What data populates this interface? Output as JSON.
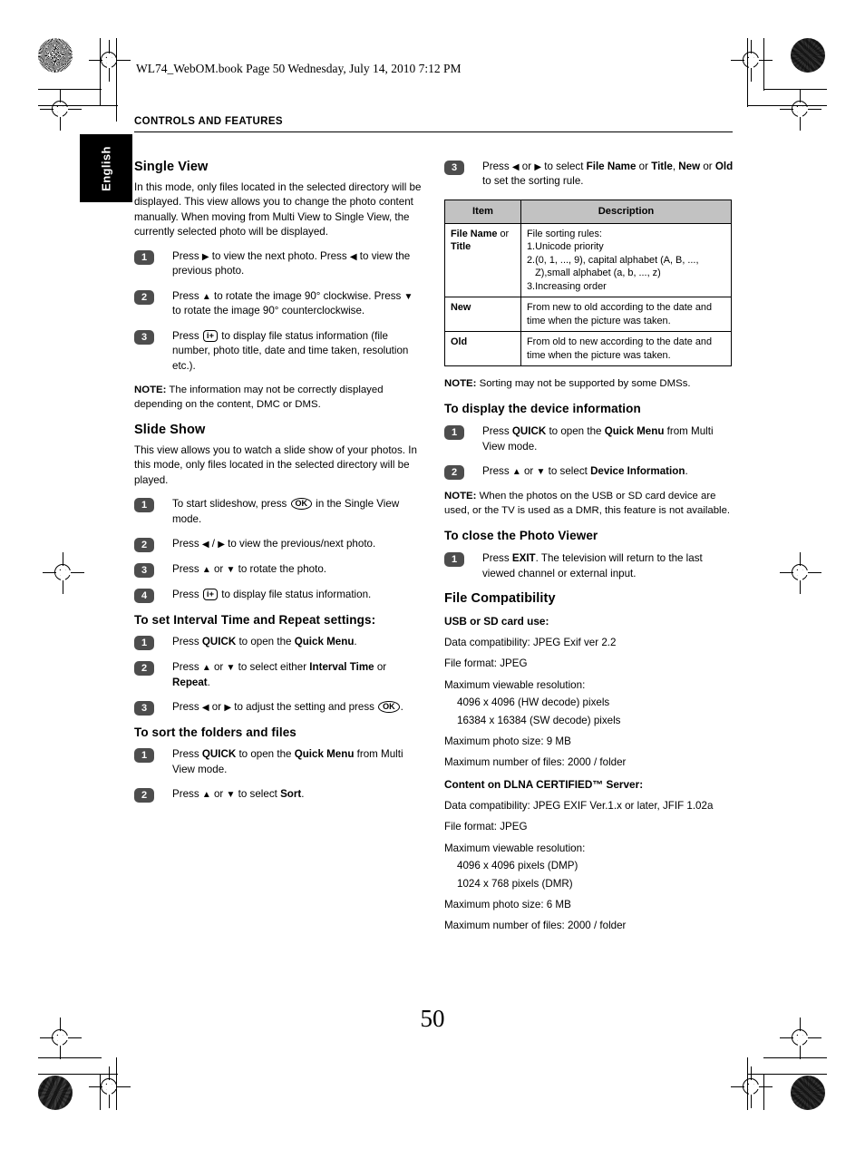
{
  "print": {
    "file_line": "WL74_WebOM.book  Page 50  Wednesday, July 14, 2010  7:12 PM",
    "running_head": "CONTROLS AND FEATURES",
    "language_tab": "English",
    "page_number": "50"
  },
  "left_column": {
    "single_view": {
      "heading": "Single View",
      "intro": "In this mode, only files located in the selected directory will be displayed. This view allows you to change the photo content manually. When moving from Multi View to Single View, the currently selected photo will be displayed.",
      "steps": [
        {
          "num": "1",
          "text_a": "Press ",
          "arrow_a": "▶",
          "text_b": " to view the next photo. Press ",
          "arrow_b": "◀",
          "text_c": " to view the previous photo."
        },
        {
          "num": "2",
          "text_a": "Press ",
          "arrow_a": "▲",
          "text_b": " to rotate the image 90° clockwise. Press ",
          "arrow_b": "▼",
          "text_c": " to rotate the image 90° counterclockwise."
        },
        {
          "num": "3",
          "text_a": "Press ",
          "key": "i+",
          "text_b": " to display file status information (file number, photo title, date and time taken, resolution etc.)."
        }
      ],
      "note_label": "NOTE:",
      "note_text": " The information may not be correctly displayed depending on the content, DMC or DMS."
    },
    "slide_show": {
      "heading": "Slide Show",
      "intro": "This view allows you to watch a slide show of your photos. In this mode, only files located in the selected directory will be played.",
      "steps": [
        {
          "num": "1",
          "text_a": "To start slideshow, press ",
          "key": "OK",
          "text_b": " in the Single View mode."
        },
        {
          "num": "2",
          "text_a": "Press ",
          "arrow_a": "◀",
          "text_b": " / ",
          "arrow_b": "▶",
          "text_c": " to view the previous/next photo."
        },
        {
          "num": "3",
          "text_a": "Press ",
          "arrow_a": "▲",
          "text_b": " or ",
          "arrow_b": "▼",
          "text_c": " to rotate the photo."
        },
        {
          "num": "4",
          "text_a": "Press ",
          "key": "i+",
          "text_b": " to display file status information."
        }
      ]
    },
    "interval_section": {
      "heading": "To set Interval Time and Repeat settings:",
      "steps": [
        {
          "num": "1",
          "t1": "Press ",
          "b1": "QUICK",
          "t2": " to open the ",
          "b2": "Quick Menu",
          "t3": "."
        },
        {
          "num": "2",
          "t1": "Press ",
          "arrow_a": "▲",
          "t2": " or ",
          "arrow_b": "▼",
          "t3": " to select either ",
          "b1": "Interval Time",
          "t4": " or ",
          "b2": "Repeat",
          "t5": "."
        },
        {
          "num": "3",
          "t1": "Press ",
          "arrow_a": "◀",
          "t2": " or ",
          "arrow_b": "▶",
          "t3": " to adjust the setting and press ",
          "key": "OK",
          "t4": "."
        }
      ]
    },
    "sort_section": {
      "heading": "To sort the folders and files",
      "steps": [
        {
          "num": "1",
          "t1": "Press ",
          "b1": "QUICK",
          "t2": " to open the ",
          "b2": "Quick Menu",
          "t3": " from Multi View mode."
        },
        {
          "num": "2",
          "t1": "Press ",
          "arrow_a": "▲",
          "t2": " or ",
          "arrow_b": "▼",
          "t3": " to select ",
          "b1": "Sort",
          "t4": "."
        }
      ]
    }
  },
  "right_column": {
    "sort_step3": {
      "num": "3",
      "t1": "Press ",
      "arrow_a": "◀",
      "t2": " or ",
      "arrow_b": "▶",
      "t3": " to select ",
      "b1": "File Name",
      "t4": " or ",
      "b2": "Title",
      "t5": ", ",
      "b3": "New",
      "t6": " or ",
      "b4": "Old",
      "t7": " to set the sorting rule."
    },
    "table": {
      "headers": [
        "Item",
        "Description"
      ],
      "rows": [
        {
          "item_bold": "File Name",
          "item_plain": " or ",
          "item_bold2": "Title",
          "desc_intro": "File sorting rules:",
          "list": [
            {
              "n": "1.",
              "t": "Unicode priority"
            },
            {
              "n": "2.",
              "t": "(0, 1, ..., 9), capital alphabet (A, B, ..., Z),",
              "t_indent": "small alphabet (a, b, ..., z)"
            },
            {
              "n": "3.",
              "t": "Increasing order"
            }
          ]
        },
        {
          "item_bold": "New",
          "desc": "From new to old according to the date and time when the picture was taken."
        },
        {
          "item_bold": "Old",
          "desc": "From old to new according to the date and time when the picture was taken."
        }
      ]
    },
    "note_sorting_label": "NOTE:",
    "note_sorting_text": " Sorting may not be supported by some DMSs.",
    "device_info": {
      "heading": "To display the device information",
      "steps": [
        {
          "num": "1",
          "t1": "Press ",
          "b1": "QUICK",
          "t2": " to open the ",
          "b2": "Quick Menu",
          "t3": " from Multi View mode."
        },
        {
          "num": "2",
          "t1": "Press ",
          "arrow_a": "▲",
          "t2": " or ",
          "arrow_b": "▼",
          "t3": " to select ",
          "b1": "Device Information",
          "t4": "."
        }
      ],
      "note_label": "NOTE:",
      "note_text": " When the photos on the USB or SD card device are used, or the TV is used as a DMR, this feature is not available."
    },
    "close_viewer": {
      "heading": "To close the Photo Viewer",
      "steps": [
        {
          "num": "1",
          "t1": "Press ",
          "b1": "EXIT",
          "t2": ". The television will return to the last viewed channel or external input."
        }
      ]
    },
    "file_compatibility": {
      "heading": "File Compatibility",
      "usb": {
        "subheading": "USB or SD card use:",
        "lines": [
          "Data compatibility: JPEG Exif ver 2.2",
          "File format: JPEG",
          "Maximum viewable resolution:"
        ],
        "indented": [
          "4096 x 4096 (HW decode) pixels",
          "16384 x 16384 (SW decode) pixels"
        ],
        "lines_after": [
          "Maximum photo size: 9 MB",
          "Maximum number of files: 2000 / folder"
        ]
      },
      "dlna": {
        "subheading": "Content on DLNA CERTIFIED™ Server:",
        "lines": [
          "Data compatibility: JPEG EXIF Ver.1.x or later, JFIF 1.02a",
          "File format: JPEG",
          "Maximum viewable resolution:"
        ],
        "indented": [
          "4096 x 4096 pixels (DMP)",
          "1024 x 768 pixels (DMR)"
        ],
        "lines_after": [
          "Maximum photo size: 6 MB",
          "Maximum number of files: 2000 / folder"
        ]
      }
    }
  }
}
